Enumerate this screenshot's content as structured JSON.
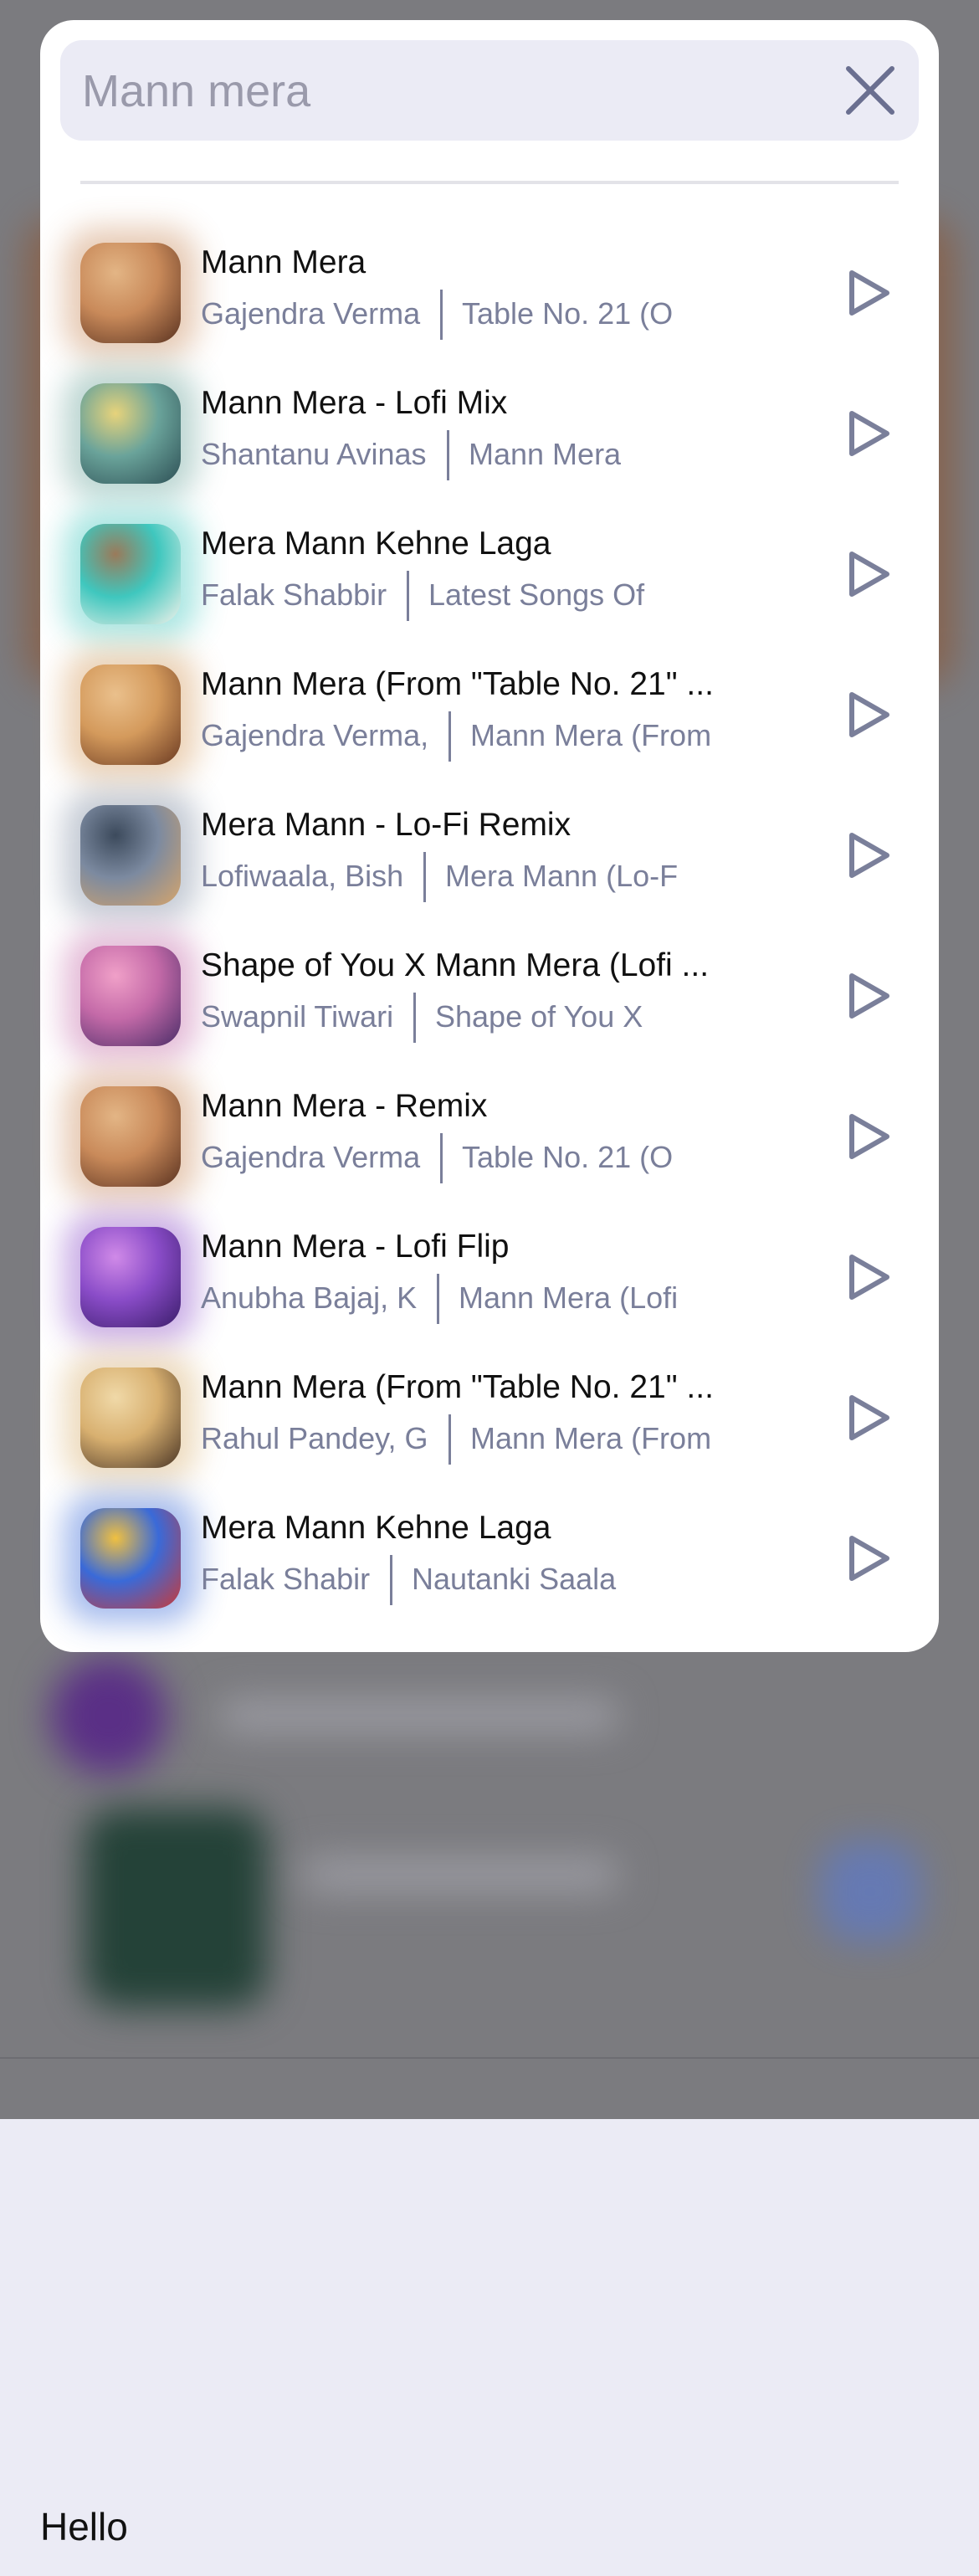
{
  "search": {
    "placeholder": "Mann mera",
    "close_icon": "close-icon"
  },
  "results": [
    {
      "title": "Mann Mera",
      "artist": "Gajendra Verma",
      "album": "Table No. 21 (O",
      "colors": [
        "#c98a5a",
        "#5a3220",
        "#e3b585"
      ]
    },
    {
      "title": "Mann Mera - Lofi Mix",
      "artist": "Shantanu Avinas",
      "album": "Mann Mera",
      "colors": [
        "#6aa39a",
        "#2d4f55",
        "#e7d37b"
      ]
    },
    {
      "title": "Mera Mann Kehne Laga",
      "artist": "Falak Shabbir",
      "album": "Latest Songs Of",
      "colors": [
        "#3fc7be",
        "#f1f1ea",
        "#9a7a5a"
      ]
    },
    {
      "title": "Mann Mera (From \"Table No. 21\" ...",
      "artist": "Gajendra Verma,",
      "album": "Mann Mera (From",
      "colors": [
        "#d49a5c",
        "#6b3a22",
        "#eac08c"
      ]
    },
    {
      "title": "Mera Mann - Lo-Fi Remix",
      "artist": "Lofiwaala, Bish",
      "album": "Mera Mann (Lo-F",
      "colors": [
        "#7c8aa0",
        "#d6a56b",
        "#3c4a5c"
      ]
    },
    {
      "title": "Shape of You X Mann Mera (Lofi ...",
      "artist": "Swapnil Tiwari",
      "album": "Shape of You X",
      "colors": [
        "#c46aa8",
        "#4a2d68",
        "#f0a0c8"
      ]
    },
    {
      "title": "Mann Mera - Remix",
      "artist": "Gajendra Verma",
      "album": "Table No. 21 (O",
      "colors": [
        "#c98a5a",
        "#5a3220",
        "#e3b585"
      ]
    },
    {
      "title": "Mann Mera - Lofi Flip",
      "artist": "Anubha Bajaj, K",
      "album": "Mann Mera (Lofi",
      "colors": [
        "#8a4cc8",
        "#3a1d6a",
        "#d08ae8"
      ]
    },
    {
      "title": "Mann Mera (From \"Table No. 21\" ...",
      "artist": "Rahul Pandey, G",
      "album": "Mann Mera (From",
      "colors": [
        "#d8b070",
        "#4a3525",
        "#f0d9a8"
      ]
    },
    {
      "title": "Mera Mann Kehne Laga",
      "artist": "Falak Shabir",
      "album": "Nautanki Saala",
      "colors": [
        "#3a6ad8",
        "#c83a3a",
        "#f0c040"
      ]
    }
  ],
  "play_icon": "play-icon",
  "footer": {
    "text": "Hello"
  }
}
